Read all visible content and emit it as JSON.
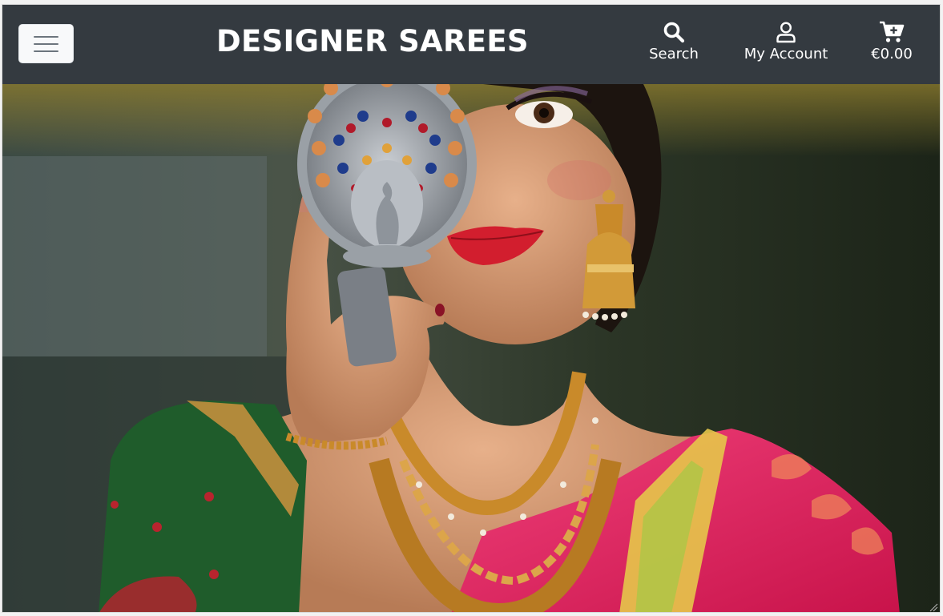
{
  "header": {
    "brand": "DESIGNER SAREES",
    "nav": {
      "search_label": "Search",
      "account_label": "My Account",
      "cart_total": "€0.00"
    },
    "icons": {
      "menu": "hamburger-menu-icon",
      "search": "search-icon",
      "account": "user-icon",
      "cart": "cart-plus-icon"
    }
  },
  "colors": {
    "navbar_bg": "#343a40",
    "nav_text": "#ffffff",
    "menu_button_bg": "#f8f9fa",
    "saree_pink": "#e8215a",
    "blouse_green": "#1f5c2b",
    "gold": "#c98a2a"
  }
}
